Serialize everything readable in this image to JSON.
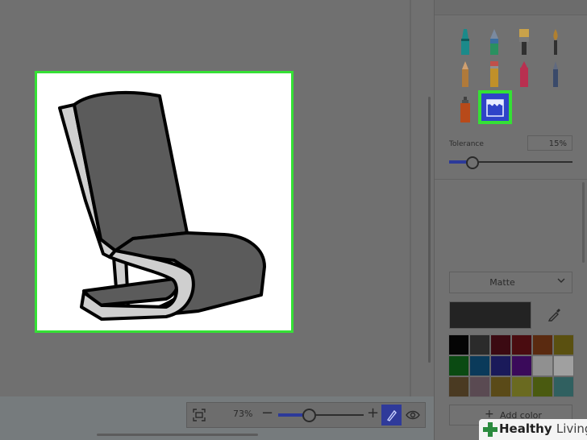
{
  "brushes": [
    {
      "name": "marker",
      "color": "#1b8a8a"
    },
    {
      "name": "calligraphy-pen",
      "color": "#3a6ea0"
    },
    {
      "name": "oil-brush",
      "color": "#c9a24a"
    },
    {
      "name": "watercolor",
      "color": "#b08030"
    },
    {
      "name": "pixel-pencil",
      "color": "#b07a3a"
    },
    {
      "name": "pencil-eraser",
      "color": "#c0504a"
    },
    {
      "name": "crayon",
      "color": "#b83050"
    },
    {
      "name": "pencil",
      "color": "#3a4a6a"
    },
    {
      "name": "spray-can",
      "color": "#b84a1a"
    },
    {
      "name": "fill-bucket",
      "color": "#2f43c8"
    }
  ],
  "tolerance": {
    "label": "Tolerance",
    "value_text": "15%",
    "value": 15
  },
  "material": {
    "selected": "Matte"
  },
  "current_color": "#232323",
  "palette": [
    "#050505",
    "#2b2b2b",
    "#3b0a12",
    "#4a0c10",
    "#5a2a10",
    "#5a5010",
    "#0a4a12",
    "#0a3a5a",
    "#1a1a5a",
    "#3a0a5a",
    "#909090",
    "#a0a0a0",
    "#4a3a22",
    "#5a4a52",
    "#5a4a18",
    "#6a6a20",
    "#4a5a10",
    "#306060"
  ],
  "add_color_label": "Add color",
  "zoom": {
    "value_text": "73%",
    "value": 73
  },
  "watermark": {
    "bold": "Healthy",
    "light": "Living"
  }
}
